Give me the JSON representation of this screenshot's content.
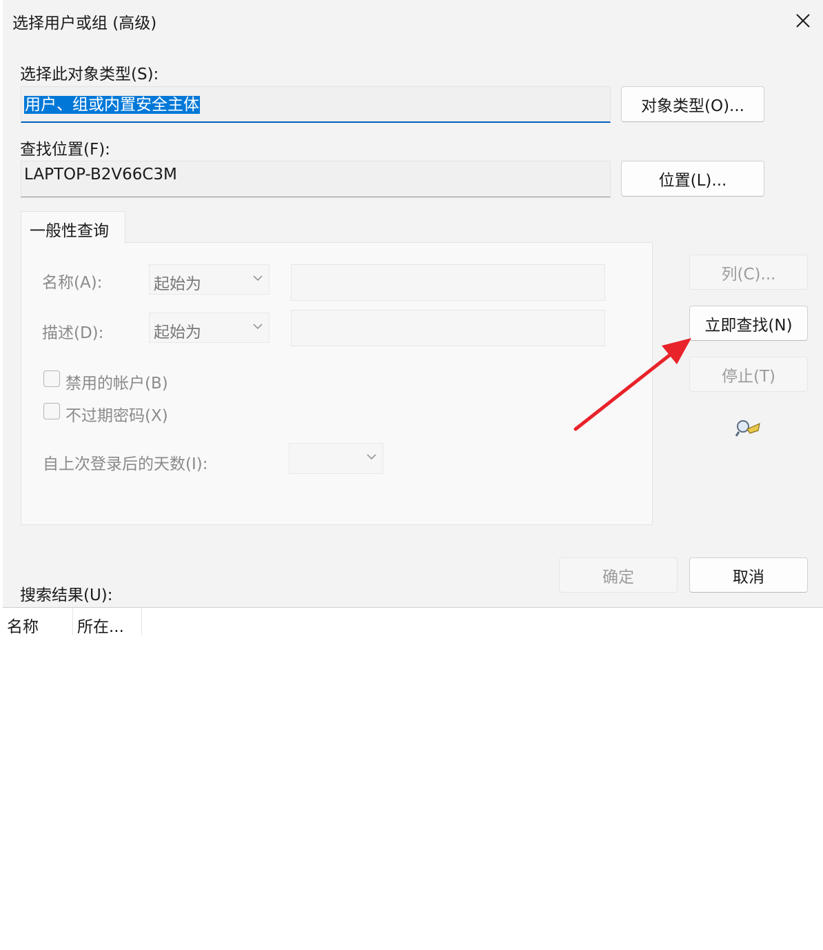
{
  "window": {
    "title": "选择用户或组 (高级)"
  },
  "object_type": {
    "label": "选择此对象类型(S):",
    "value": "用户、组或内置安全主体",
    "button": "对象类型(O)..."
  },
  "location": {
    "label": "查找位置(F):",
    "value": "LAPTOP-B2V66C3M",
    "button": "位置(L)..."
  },
  "query": {
    "tab_label": "一般性查询",
    "name_label": "名称(A):",
    "name_mode": "起始为",
    "desc_label": "描述(D):",
    "desc_mode": "起始为",
    "disabled_accounts": "禁用的帐户(B)",
    "non_expiring_pw": "不过期密码(X)",
    "days_since_login": "自上次登录后的天数(I):"
  },
  "side_buttons": {
    "columns": "列(C)...",
    "find_now": "立即查找(N)",
    "stop": "停止(T)"
  },
  "footer": {
    "ok": "确定",
    "cancel": "取消"
  },
  "results": {
    "label": "搜索结果(U):",
    "columns": [
      "名称",
      "所在..."
    ]
  },
  "colors": {
    "selection": "#0078d7",
    "focus_underline": "#005fb8",
    "annotation_arrow": "#e8232a"
  }
}
